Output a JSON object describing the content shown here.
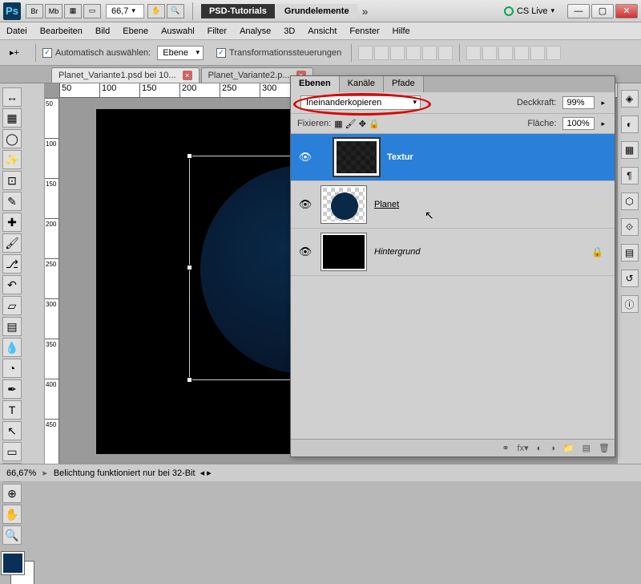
{
  "titlebar": {
    "ps": "Ps",
    "buttons": [
      "Br",
      "Mb"
    ],
    "zoom": "66,7",
    "app1": "PSD-Tutorials",
    "app2": "Grundelemente",
    "cslive": "CS Live"
  },
  "menu": [
    "Datei",
    "Bearbeiten",
    "Bild",
    "Ebene",
    "Auswahl",
    "Filter",
    "Analyse",
    "3D",
    "Ansicht",
    "Fenster",
    "Hilfe"
  ],
  "optbar": {
    "auto_select": "Automatisch auswählen:",
    "auto_select_val": "Ebene",
    "transform": "Transformationssteuerungen"
  },
  "doc_tabs": [
    {
      "label": "Planet_Variante1.psd bei 10...",
      "active": true
    },
    {
      "label": "Planet_Variante2.p...",
      "active": false
    }
  ],
  "ruler_h": [
    "50",
    "100",
    "150",
    "200",
    "250",
    "300"
  ],
  "ruler_v": [
    "50",
    "100",
    "150",
    "200",
    "250",
    "300",
    "350",
    "400",
    "450"
  ],
  "panel": {
    "tabs": [
      "Ebenen",
      "Kanäle",
      "Pfade"
    ],
    "blend_mode": "Ineinanderkopieren",
    "opacity_label": "Deckkraft:",
    "opacity": "99%",
    "lock_label": "Fixieren:",
    "fill_label": "Fläche:",
    "fill": "100%",
    "layers": [
      {
        "name": "Textur",
        "selected": true
      },
      {
        "name": "Planet",
        "selected": false,
        "underline": true
      },
      {
        "name": "Hintergrund",
        "selected": false,
        "italic": true,
        "locked": true
      }
    ]
  },
  "status": {
    "zoom": "66,67%",
    "msg": "Belichtung funktioniert nur bei 32-Bit"
  }
}
